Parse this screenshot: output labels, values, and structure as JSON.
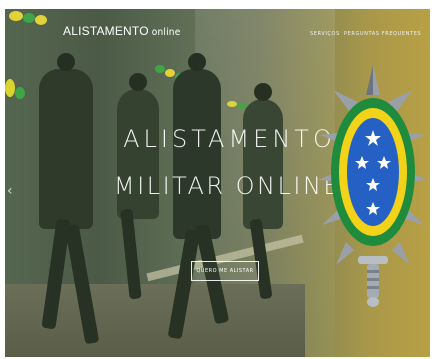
{
  "header": {
    "brand_main": "ALISTAMENTO",
    "brand_suffix": "online",
    "nav": [
      "SERVIÇOS",
      "PERGUNTAS FREQUENTES"
    ]
  },
  "hero": {
    "title_line1": "ALISTAMENTO",
    "title_line2": "MILITAR ONLINE",
    "cta_label": "QUERO ME ALISTAR",
    "prev_icon": "chevron-left-icon"
  },
  "emblem": {
    "name": "army-emblem",
    "colors": {
      "green": "#1f8b3c",
      "yellow": "#f3d21a",
      "blue": "#2561c4",
      "silver": "#9aa0a8"
    }
  }
}
